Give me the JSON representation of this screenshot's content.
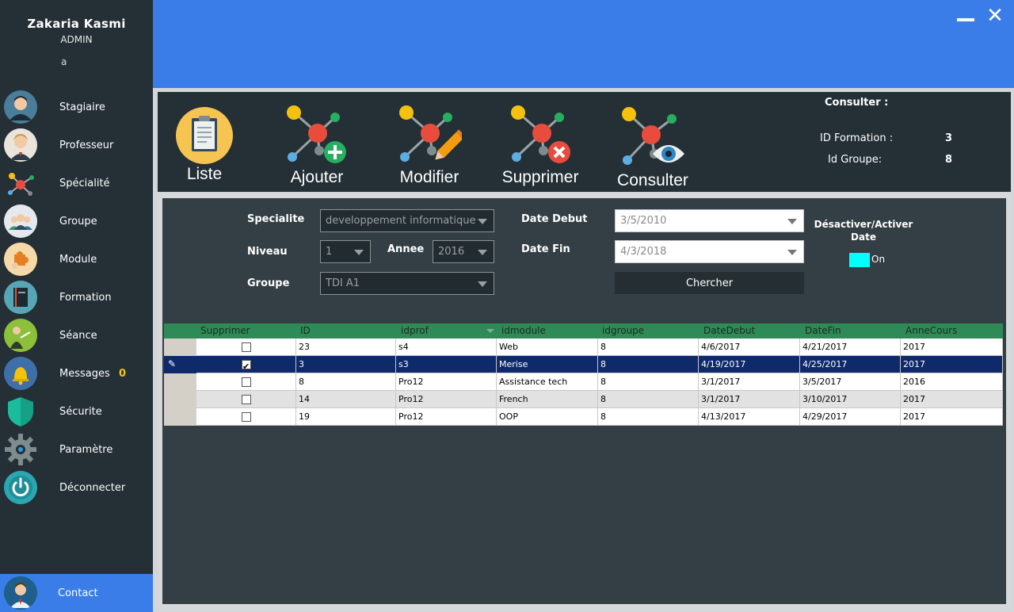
{
  "user": {
    "name": "Zakaria Kasmi",
    "role": "ADMIN",
    "status": "a"
  },
  "sidebar": {
    "items": [
      {
        "label": "Stagiaire",
        "icon": "student-avatar-icon"
      },
      {
        "label": "Professeur",
        "icon": "teacher-avatar-icon"
      },
      {
        "label": "Spécialité",
        "icon": "molecule-icon"
      },
      {
        "label": "Groupe",
        "icon": "group-icon"
      },
      {
        "label": "Module",
        "icon": "puzzle-icon"
      },
      {
        "label": "Formation",
        "icon": "book-icon"
      },
      {
        "label": "Séance",
        "icon": "presenter-icon"
      },
      {
        "label": "Messages",
        "icon": "bell-icon",
        "badge": "0"
      },
      {
        "label": "Sécurite",
        "icon": "shield-icon"
      },
      {
        "label": "Paramètre",
        "icon": "gear-icon"
      },
      {
        "label": "Déconnecter",
        "icon": "power-icon"
      }
    ],
    "contact": "Contact"
  },
  "window": {
    "minimize": "minimize-icon",
    "close": "✕"
  },
  "toolbar": {
    "liste": "Liste",
    "ajouter": "Ajouter",
    "modifier": "Modifier",
    "supprimer": "Supprimer",
    "consulter": "Consulter"
  },
  "consult": {
    "title": "Consulter :",
    "id_formation_label": "ID Formation :",
    "id_formation": "3",
    "id_groupe_label": "Id Groupe:",
    "id_groupe": "8"
  },
  "filters": {
    "specialite_label": "Specialite",
    "specialite": "developpement informatique",
    "niveau_label": "Niveau",
    "niveau": "1",
    "annee_label": "Annee",
    "annee": "2016",
    "groupe_label": "Groupe",
    "groupe": "TDI A1",
    "date_debut_label": "Date Debut",
    "date_debut": "3/5/2010",
    "date_fin_label": "Date Fin",
    "date_fin": "4/3/2018",
    "search": "Chercher",
    "toggle_title": "Désactiver/Activer Date",
    "toggle_state": "On"
  },
  "grid": {
    "columns": [
      "Supprimer",
      "ID",
      "idprof",
      "idmodule",
      "idgroupe",
      "DateDebut",
      "DateFin",
      "AnneCours"
    ],
    "rows": [
      {
        "checked": false,
        "cells": [
          "23",
          "s4",
          "Web",
          "8",
          "4/6/2017",
          "4/21/2017",
          "2017"
        ]
      },
      {
        "checked": true,
        "cells": [
          "3",
          "s3",
          "Merise",
          "8",
          "4/19/2017",
          "4/25/2017",
          "2017"
        ]
      },
      {
        "checked": false,
        "cells": [
          "8",
          "Pro12",
          "Assistance tech",
          "8",
          "3/1/2017",
          "3/5/2017",
          "2016"
        ]
      },
      {
        "checked": false,
        "cells": [
          "14",
          "Pro12",
          "French",
          "8",
          "3/1/2017",
          "3/10/2017",
          "2017"
        ]
      },
      {
        "checked": false,
        "cells": [
          "19",
          "Pro12",
          "OOP",
          "8",
          "4/13/2017",
          "4/29/2017",
          "2017"
        ]
      }
    ],
    "selected_index": 1
  },
  "colors": {
    "accent": "#3a7de8",
    "sidebar": "#242f36",
    "grid_header": "#2e8b57",
    "selected_row": "#0e2a6b",
    "toggle_on": "#00ffff",
    "badge": "#f5c518"
  }
}
